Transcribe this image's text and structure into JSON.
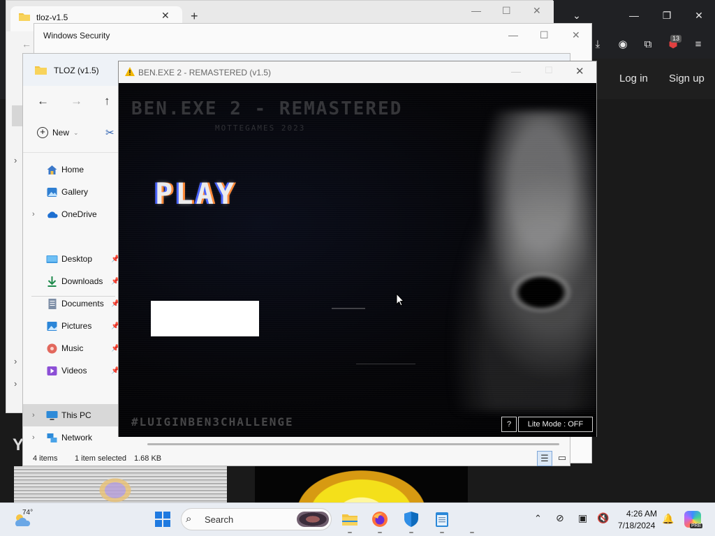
{
  "browser": {
    "login_label": "Log in",
    "signup_label": "Sign up",
    "extension_badge": "13",
    "tab_title": "tloz-v1.5",
    "section_letter": "Y"
  },
  "security_window": {
    "title": "Windows Security"
  },
  "explorer": {
    "title": "TLOZ (v1.5)",
    "new_label": "New",
    "nav_items": [
      {
        "label": "Home",
        "icon": "home-icon"
      },
      {
        "label": "Gallery",
        "icon": "gallery-icon"
      },
      {
        "label": "OneDrive",
        "icon": "onedrive-icon"
      },
      {
        "label": "Desktop",
        "icon": "desktop-icon"
      },
      {
        "label": "Downloads",
        "icon": "downloads-icon"
      },
      {
        "label": "Documents",
        "icon": "documents-icon"
      },
      {
        "label": "Pictures",
        "icon": "pictures-icon"
      },
      {
        "label": "Music",
        "icon": "music-icon"
      },
      {
        "label": "Videos",
        "icon": "videos-icon"
      },
      {
        "label": "This PC",
        "icon": "this-pc-icon"
      },
      {
        "label": "Network",
        "icon": "network-icon"
      }
    ],
    "status": {
      "count": "4 items",
      "selected": "1 item selected",
      "size": "1.68 KB"
    }
  },
  "game": {
    "window_title": "BEN.EXE 2 - REMASTERED (v1.5)",
    "heading": "BEN.EXE 2 - REMASTERED",
    "subheading": "MOTTEGAMES 2023",
    "play_label": "PLAY",
    "hashtag": "#LUIGINBEN3CHALLENGE",
    "help_label": "?",
    "lite_mode_label": "Lite Mode : OFF"
  },
  "taskbar": {
    "weather_temp": "74°",
    "search_label": "Search",
    "clock_time": "4:26 AM",
    "clock_date": "7/18/2024",
    "copilot_badge": "PRE"
  },
  "colors": {
    "taskbar_bg": "#e9edf3",
    "browser_dark": "#202124",
    "accent_blue": "#0078d4",
    "game_bg": "#000000"
  }
}
